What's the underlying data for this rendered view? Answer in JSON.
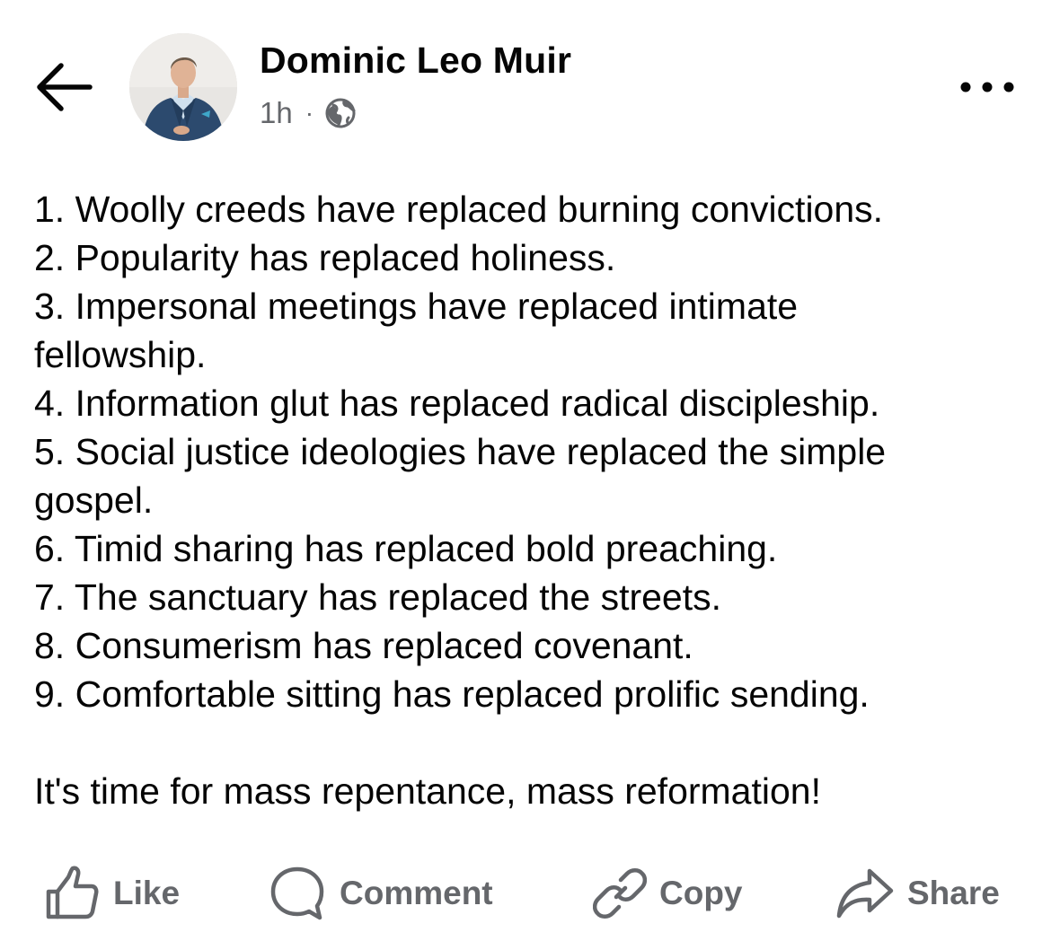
{
  "header": {
    "author_name": "Dominic Leo Muir",
    "timestamp": "1h",
    "separator": "·",
    "back_icon": "arrow-left-icon",
    "privacy_icon": "globe-icon",
    "more_icon": "more-dots-icon"
  },
  "post": {
    "lines": [
      "1. Woolly creeds have replaced burning convictions.",
      "2. Popularity has replaced holiness.",
      "3. Impersonal meetings have replaced intimate",
      "fellowship.",
      "4. Information glut has replaced radical discipleship.",
      "5. Social justice ideologies have replaced the simple",
      "gospel.",
      "6. Timid sharing has replaced bold preaching.",
      "7. The sanctuary has replaced the streets.",
      "8. Consumerism has replaced covenant.",
      "9. Comfortable sitting has replaced prolific sending."
    ],
    "closing": "It's time for mass repentance, mass reformation!"
  },
  "actions": {
    "like": {
      "label": "Like",
      "icon": "thumbs-up-icon"
    },
    "comment": {
      "label": "Comment",
      "icon": "comment-bubble-icon"
    },
    "copy": {
      "label": "Copy",
      "icon": "link-icon"
    },
    "share": {
      "label": "Share",
      "icon": "share-arrow-icon"
    }
  },
  "colors": {
    "text": "#050505",
    "secondary_text": "#65676b",
    "background": "#ffffff"
  }
}
